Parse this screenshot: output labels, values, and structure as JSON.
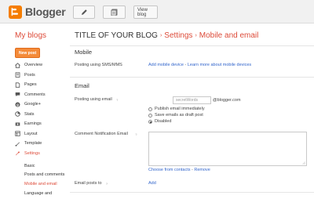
{
  "topbar": {
    "brand": "Blogger",
    "view_blog": "View blog"
  },
  "header": {
    "my_blogs": "My blogs",
    "blog_title": "TITLE OF YOUR BLOG",
    "crumb_settings": "Settings",
    "crumb_page": "Mobile and email"
  },
  "sidebar": {
    "new_post": "New post",
    "items": [
      {
        "label": "Overview",
        "icon": "overview-icon"
      },
      {
        "label": "Posts",
        "icon": "posts-icon"
      },
      {
        "label": "Pages",
        "icon": "pages-icon"
      },
      {
        "label": "Comments",
        "icon": "comments-icon"
      },
      {
        "label": "Google+",
        "icon": "google-plus-icon"
      },
      {
        "label": "Stats",
        "icon": "stats-icon"
      },
      {
        "label": "Earnings",
        "icon": "earnings-icon"
      },
      {
        "label": "Layout",
        "icon": "layout-icon"
      },
      {
        "label": "Template",
        "icon": "template-icon"
      },
      {
        "label": "Settings",
        "icon": "settings-icon"
      }
    ],
    "sub_items": [
      {
        "label": "Basic"
      },
      {
        "label": "Posts and comments"
      },
      {
        "label": "Mobile and email"
      },
      {
        "label": "Language and"
      }
    ]
  },
  "mobile": {
    "title": "Mobile",
    "sms_label": "Posting using SMS/MMS",
    "add_device": "Add mobile device",
    "dash": " - ",
    "learn_more": "Learn more about mobile devices"
  },
  "email": {
    "title": "Email",
    "posting_label": "Posting using email",
    "secret_placeholder": "secretWords",
    "domain": "@blogger.com",
    "options": [
      {
        "label": "Publish email immediately",
        "checked": false
      },
      {
        "label": "Save emails as draft post",
        "checked": false
      },
      {
        "label": "Disabled",
        "checked": true
      }
    ],
    "comment_label": "Comment Notification Email",
    "choose_contacts": "Choose from contacts",
    "dash": " - ",
    "remove": "Remove",
    "posts_to_label": "Email posts to",
    "add": "Add",
    "help": "?"
  },
  "colors": {
    "accent": "#dd4b39",
    "brand": "#f57d00",
    "link": "#3366cc"
  }
}
